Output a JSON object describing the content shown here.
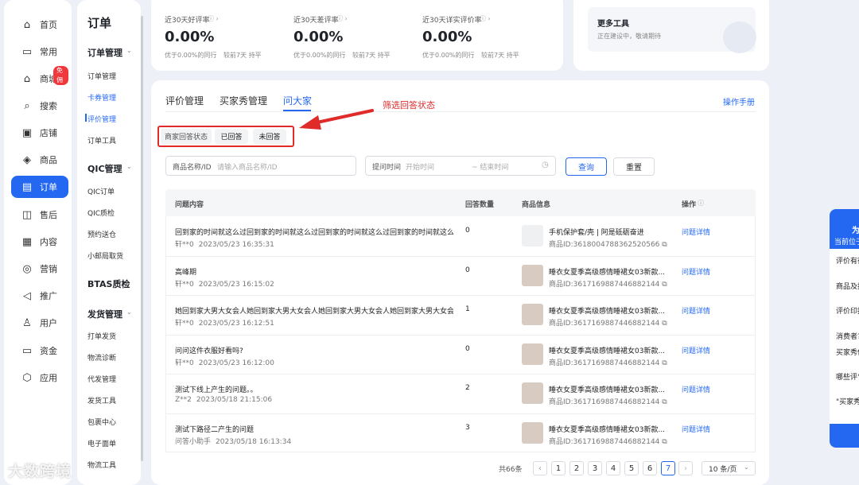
{
  "nav": {
    "items": [
      {
        "label": "首页",
        "icon": "home-icon"
      },
      {
        "label": "常用",
        "icon": "folder-icon"
      },
      {
        "label": "商城",
        "icon": "shop-icon",
        "badge": "免佣"
      },
      {
        "label": "搜索",
        "icon": "search-icon"
      },
      {
        "label": "店铺",
        "icon": "store-icon"
      },
      {
        "label": "商品",
        "icon": "box-icon"
      },
      {
        "label": "订单",
        "icon": "order-icon"
      },
      {
        "label": "售后",
        "icon": "aftersale-icon"
      },
      {
        "label": "内容",
        "icon": "content-icon"
      },
      {
        "label": "营销",
        "icon": "marketing-icon"
      },
      {
        "label": "推广",
        "icon": "promotion-icon"
      },
      {
        "label": "用户",
        "icon": "user-icon"
      },
      {
        "label": "资金",
        "icon": "money-icon"
      },
      {
        "label": "应用",
        "icon": "app-icon"
      }
    ]
  },
  "subnav": {
    "title": "订单",
    "groups": {
      "order_mgmt": "订单管理",
      "qic_mgmt": "QIC管理",
      "btas": "BTAS质检",
      "ship_mgmt": "发货管理"
    },
    "order_items": [
      "订单管理",
      "卡券管理",
      "评价管理",
      "订单工具"
    ],
    "qic_items": [
      "QIC订单",
      "QIC质检",
      "预约送仓",
      "小邮局取货"
    ],
    "ship_items": [
      "打单发货",
      "物流诊断",
      "代发管理",
      "发货工具",
      "包裹中心",
      "电子面单",
      "物流工具"
    ]
  },
  "stats": [
    {
      "label": "近30天好评率",
      "value": "0.00%",
      "sub": "优于0.00%的同行",
      "compare": "较前7天 持平"
    },
    {
      "label": "近30天差评率",
      "value": "0.00%",
      "sub": "优于0.00%的同行",
      "compare": "较前7天 持平"
    },
    {
      "label": "近30天详实评价率",
      "value": "0.00%",
      "sub": "优于0.00%的同行",
      "compare": "较前7天 持平"
    }
  ],
  "tools": {
    "title": "更多工具",
    "desc": "正在建设中，敬请期待"
  },
  "tabs": [
    "评价管理",
    "买家秀管理",
    "问大家"
  ],
  "manual_link": "操作手册",
  "annotation": "筛选回答状态",
  "filter": {
    "label": "商家回答状态",
    "answered": "已回答",
    "unanswered": "未回答"
  },
  "search": {
    "product_label": "商品名称/ID",
    "product_placeholder": "请输入商品名称/ID",
    "time_label": "提问时间",
    "start_placeholder": "开始时间",
    "end_placeholder": "~ 结束时间",
    "query": "查询",
    "reset": "重置"
  },
  "table": {
    "headers": [
      "问题内容",
      "回答数量",
      "商品信息",
      "操作"
    ],
    "rows": [
      {
        "question": "回到家的时间就这么过回到家的时间就这么过回到家的时间就这么过回到家的时间就这么过",
        "user": "轩**0",
        "time": "2023/05/23 16:35:31",
        "count": "0",
        "product": "手机保护套/壳 | 阿是砥砺奋进",
        "pid": "商品ID:3618004788362520566",
        "action": "问题详情"
      },
      {
        "question": "高峰期",
        "user": "轩**0",
        "time": "2023/05/23 16:15:02",
        "count": "0",
        "product": "睡衣女夏季高级感情睡裙女03新款...",
        "pid": "商品ID:3617169887446882144",
        "action": "问题详情"
      },
      {
        "question": "她回到家大男大女会人她回到家大男大女会人她回到家大男大女会人她回到家大男大女会人",
        "user": "轩**0",
        "time": "2023/05/23 16:12:51",
        "count": "1",
        "product": "睡衣女夏季高级感情睡裙女03新款...",
        "pid": "商品ID:3617169887446882144",
        "action": "问题详情"
      },
      {
        "question": "问问这件衣服好看吗?",
        "user": "轩**0",
        "time": "2023/05/23 16:12:00",
        "count": "0",
        "product": "睡衣女夏季高级感情睡裙女03新款...",
        "pid": "商品ID:3617169887446882144",
        "action": "问题详情"
      },
      {
        "question": "测试下线上产生的问题。。",
        "user": "Z**2",
        "time": "2023/05/18 21:15:06",
        "count": "2",
        "product": "睡衣女夏季高级感情睡裙女03新款...",
        "pid": "商品ID:3617169887446882144",
        "action": "问题详情"
      },
      {
        "question": "测试下路径二产生的问题",
        "user": "问答小助手",
        "time": "2023/05/18 16:13:34",
        "count": "3",
        "product": "睡衣女夏季高级感情睡裙女03新款...",
        "pid": "商品ID:3617169887446882144",
        "action": "问题详情"
      }
    ]
  },
  "pagination": {
    "total": "共66条",
    "pages": [
      "1",
      "2",
      "3",
      "4",
      "5",
      "6",
      "7"
    ],
    "current": "7",
    "size": "10 条/页"
  },
  "right_panel": {
    "title": "为",
    "subtitle": "当前位子",
    "items": [
      "评价有得升流量上",
      "商品及指南",
      "评价印指什么?",
      "消费者?",
      "买家秀何设置?",
      "哪些评\"买家秀",
      "\"买家秀精?"
    ]
  },
  "watermark": "大数跨境",
  "colors": {
    "accent": "#2468f2",
    "annotation": "#e02b2b",
    "badge": "#f0373b"
  }
}
